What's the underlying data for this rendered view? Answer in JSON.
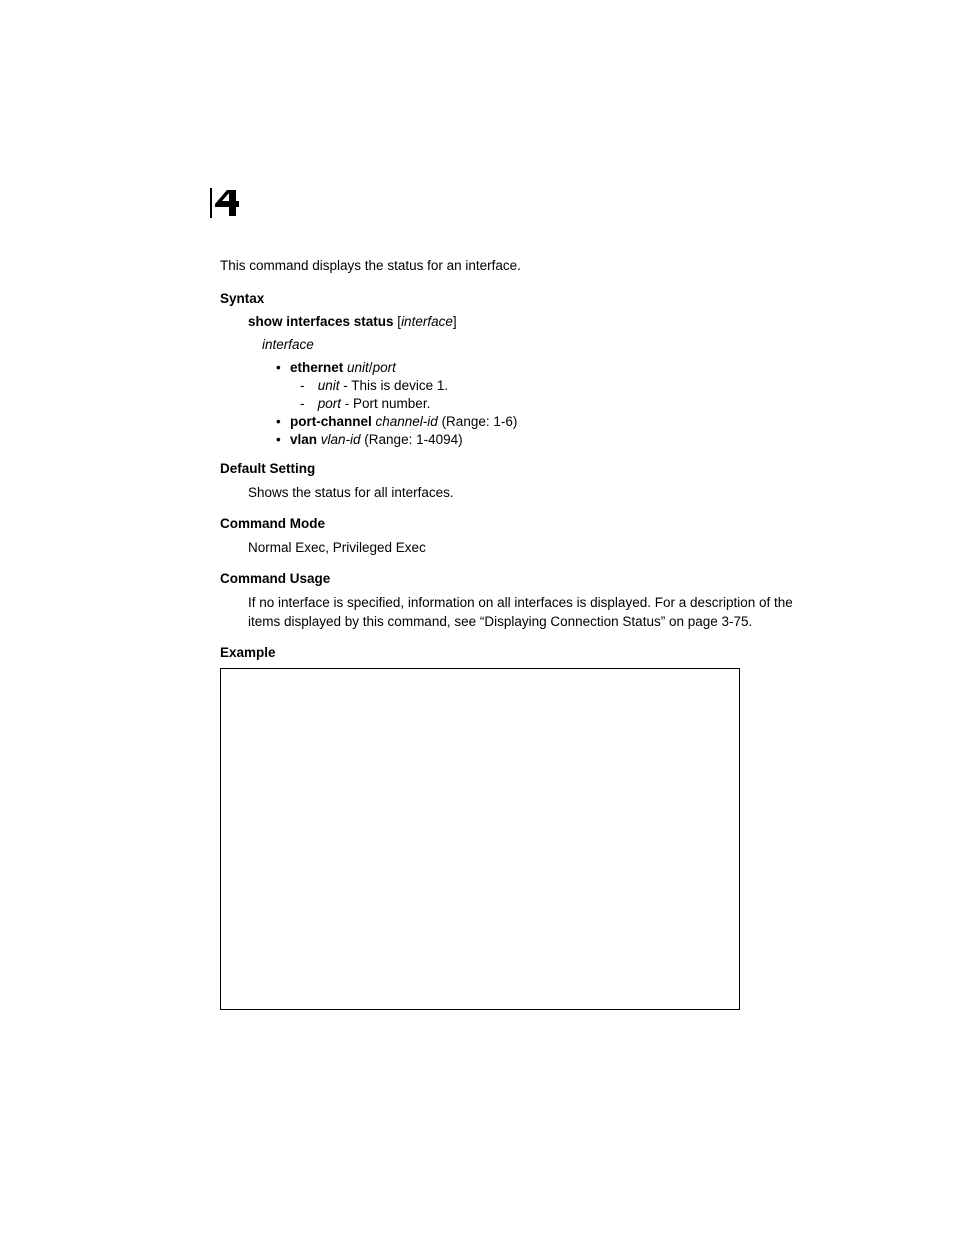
{
  "chapter": "4",
  "intro": "This command displays the status for an interface.",
  "syntax": {
    "heading": "Syntax",
    "command": "show interfaces status",
    "param_bracket_open": " [",
    "param": "interface",
    "param_bracket_close": "]",
    "interface_label": "interface",
    "items": {
      "eth_bold": "ethernet",
      "eth_args": " unit",
      "eth_slash": "/",
      "eth_port": "port",
      "unit_label": "unit",
      "unit_desc": " - This is device 1.",
      "port_label": "port",
      "port_desc": " - Port number.",
      "pc_bold": "port-channel",
      "pc_args": " channel-id",
      "pc_range": " (Range: 1-6)",
      "vlan_bold": "vlan",
      "vlan_args": " vlan-id",
      "vlan_range": " (Range: 1-4094)"
    }
  },
  "default_setting": {
    "heading": "Default Setting",
    "text": "Shows the status for all interfaces."
  },
  "command_mode": {
    "heading": "Command Mode",
    "text": "Normal Exec, Privileged Exec"
  },
  "command_usage": {
    "heading": "Command Usage",
    "text": "If no interface is specified, information on all interfaces is displayed. For a description of the items displayed by this command, see “Displaying Connection Status” on page 3-75."
  },
  "example": {
    "heading": "Example"
  }
}
